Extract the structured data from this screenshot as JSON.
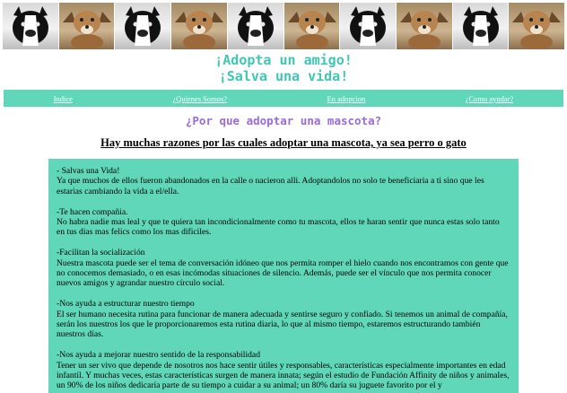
{
  "banner": {
    "tiles": [
      "border-collie-photo",
      "puppy-photo",
      "border-collie-photo",
      "puppy-photo",
      "border-collie-photo",
      "puppy-photo",
      "border-collie-photo",
      "puppy-photo",
      "border-collie-photo",
      "puppy-photo"
    ]
  },
  "header": {
    "line1": "¡Adopta un amigo!",
    "line2": "¡Salva una vida!",
    "color": "#3fc7b3"
  },
  "nav": {
    "items": [
      {
        "label": "Indice"
      },
      {
        "label": "¿Quienes Somos?"
      },
      {
        "label": "En adopcion"
      },
      {
        "label": "¿Como ayudar?"
      }
    ],
    "background": "#5fd7b8"
  },
  "main": {
    "question": "¿Por que adoptar una mascota?",
    "question_color": "#9a6ae0",
    "subtitle": "Hay muchas razones por las cuales adoptar una mascota, ya sea perro o gato",
    "content_background": "#5fd7b8",
    "sections": [
      {
        "title": "- Salvas una Vida!",
        "body": "Ya que muchos de ellos fueron abandonados en la calle o nacieron alli. Adoptandolos no solo te beneficiaria a ti sino que les estarias cambiando la vida a el/ella."
      },
      {
        "title": "-Te hacen compañia.",
        "body": "No habra nadie mas leal y que te quiera tan incondicionalmente como tu mascota, ellos te haran sentir que nunca estas solo tanto en tus dias mas felics como los mas dificiles."
      },
      {
        "title": "-Facilitan la socialización",
        "body": "Nuestra mascota puede ser el tema de conversación idóneo que nos permita romper el hielo cuando nos encontramos con gente que no conocemos demasiado, o en esas incómodas situaciones de silencio. Además, puede ser el vínculo que nos permita conocer nuevos amigos y agrandar nuestro círculo social."
      },
      {
        "title": "-Nos ayuda a estructurar nuestro tiempo",
        "body": "El ser humano necesita rutina para funcionar de manera adecuada y sentirse seguro y confiado. Si tenemos un animal de compañía, serán los nuestros los que le proporcionaremos esta rutina diaria, lo que al mismo tiempo, estaremos estructurando también nuestros días."
      },
      {
        "title": "-Nos ayuda a mejorar nuestro sentido de la responsabilidad",
        "body": "Tener un ser vivo que depende de nosotros nos hace sentir útiles y responsables, características especialmente importantes en edad infantil. Y muchas veces, estas características surgen de manera innata; según el estudio de Fundación Affinity de niños y animales, un 90% de los niños dedicaría parte de su tiempo a cuidar a su animal; un 80% daría su juguete favorito por el y"
      }
    ]
  }
}
